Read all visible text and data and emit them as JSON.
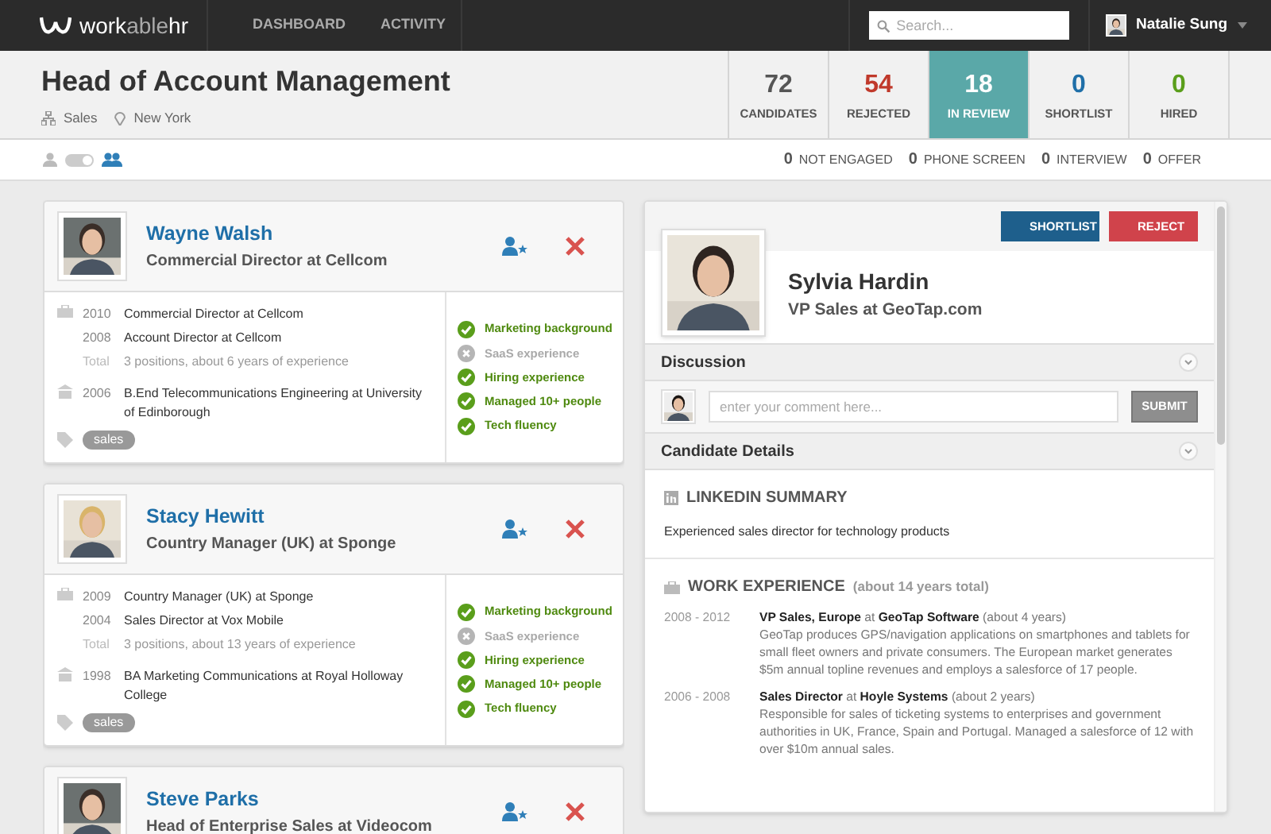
{
  "nav": {
    "logo": [
      {
        "text": "work",
        "muted": false
      },
      {
        "text": "able",
        "muted": true
      },
      {
        "text": "hr",
        "muted": false
      }
    ],
    "links": [
      {
        "label": "DASHBOARD",
        "selected": false
      },
      {
        "label": "ACTIVITY",
        "selected": false
      }
    ],
    "search": {
      "placeholder": "Search..."
    },
    "user": {
      "name": "Natalie Sung"
    }
  },
  "job": {
    "title": "Head of Account Management",
    "department": "Sales",
    "location": "New York"
  },
  "stats": [
    {
      "count": "72",
      "label": "CANDIDATES",
      "color": "#555555",
      "selected": false
    },
    {
      "count": "54",
      "label": "REJECTED",
      "color": "#c0392b",
      "selected": false
    },
    {
      "count": "18",
      "label": "IN REVIEW",
      "color": "#ffffff",
      "selected": true
    },
    {
      "count": "0",
      "label": "SHORTLIST",
      "color": "#1f6fa8",
      "selected": false
    },
    {
      "count": "0",
      "label": "HIRED",
      "color": "#5a9e1b",
      "selected": false
    }
  ],
  "view_toggle": {
    "grouped": true
  },
  "stages": [
    {
      "count": "0",
      "label": "NOT ENGAGED"
    },
    {
      "count": "0",
      "label": "PHONE SCREEN"
    },
    {
      "count": "0",
      "label": "INTERVIEW"
    },
    {
      "count": "0",
      "label": "OFFER"
    }
  ],
  "candidates": [
    {
      "name": "Wayne Walsh",
      "headline": "Commercial Director at Cellcom",
      "expanded": true,
      "positions": [
        {
          "year": "2010",
          "text": "Commercial Director at Cellcom"
        },
        {
          "year": "2008",
          "text": "Account Director at Cellcom"
        }
      ],
      "total_label": "Total",
      "total": "3 positions, about 6 years of experience",
      "education": [
        {
          "year": "2006",
          "text": "B.End Telecommunications Engineering at University of Edinborough"
        }
      ],
      "tags": [
        "sales"
      ],
      "criteria": [
        {
          "label": "Marketing background",
          "met": true
        },
        {
          "label": "SaaS experience",
          "met": false
        },
        {
          "label": "Hiring experience",
          "met": true
        },
        {
          "label": "Managed 10+ people",
          "met": true
        },
        {
          "label": "Tech fluency",
          "met": true
        }
      ]
    },
    {
      "name": "Stacy Hewitt",
      "headline": "Country Manager (UK) at Sponge",
      "expanded": true,
      "positions": [
        {
          "year": "2009",
          "text": "Country Manager (UK) at Sponge"
        },
        {
          "year": "2004",
          "text": "Sales Director at Vox Mobile"
        }
      ],
      "total_label": "Total",
      "total": "3 positions, about 13 years of experience",
      "education": [
        {
          "year": "1998",
          "text": "BA Marketing Communications at Royal Holloway College"
        }
      ],
      "tags": [
        "sales"
      ],
      "criteria": [
        {
          "label": "Marketing background",
          "met": true
        },
        {
          "label": "SaaS experience",
          "met": false
        },
        {
          "label": "Hiring experience",
          "met": true
        },
        {
          "label": "Managed 10+ people",
          "met": true
        },
        {
          "label": "Tech fluency",
          "met": true
        }
      ]
    },
    {
      "name": "Steve Parks",
      "headline": "Head of Enterprise Sales at Videocom",
      "expanded": false
    }
  ],
  "detail": {
    "buttons": [
      {
        "label": "SHORTLIST",
        "kind": "shortlist"
      },
      {
        "label": "REJECT",
        "kind": "reject"
      }
    ],
    "name": "Sylvia Hardin",
    "headline": "VP Sales at GeoTap.com",
    "discussion": {
      "title": "Discussion",
      "placeholder": "enter your comment here...",
      "submit": "SUBMIT"
    },
    "details_title": "Candidate Details",
    "linkedin": {
      "title": "LINKEDIN SUMMARY",
      "text": "Experienced sales director for technology products"
    },
    "work": {
      "title": "WORK EXPERIENCE",
      "note": "(about 14 years total)",
      "items": [
        {
          "dates": "2008 - 2012",
          "role": "**VP Sales, Europe** at **GeoTap Software** (about 4 years)",
          "text": "GeoTap produces GPS/navigation applications on smartphones and tablets for small fleet owners and private consumers. The European market generates $5m annual topline revenues and employs a salesforce of 17 people."
        },
        {
          "dates": "2006 - 2008",
          "role": "**Sales Director** at **Hoyle Systems** (about 2 years)",
          "text": "Responsible for sales of ticketing systems to enterprises and government authorities in UK, France, Spain and Portugal. Managed a salesforce of 12 with over $10m annual sales."
        }
      ]
    }
  }
}
